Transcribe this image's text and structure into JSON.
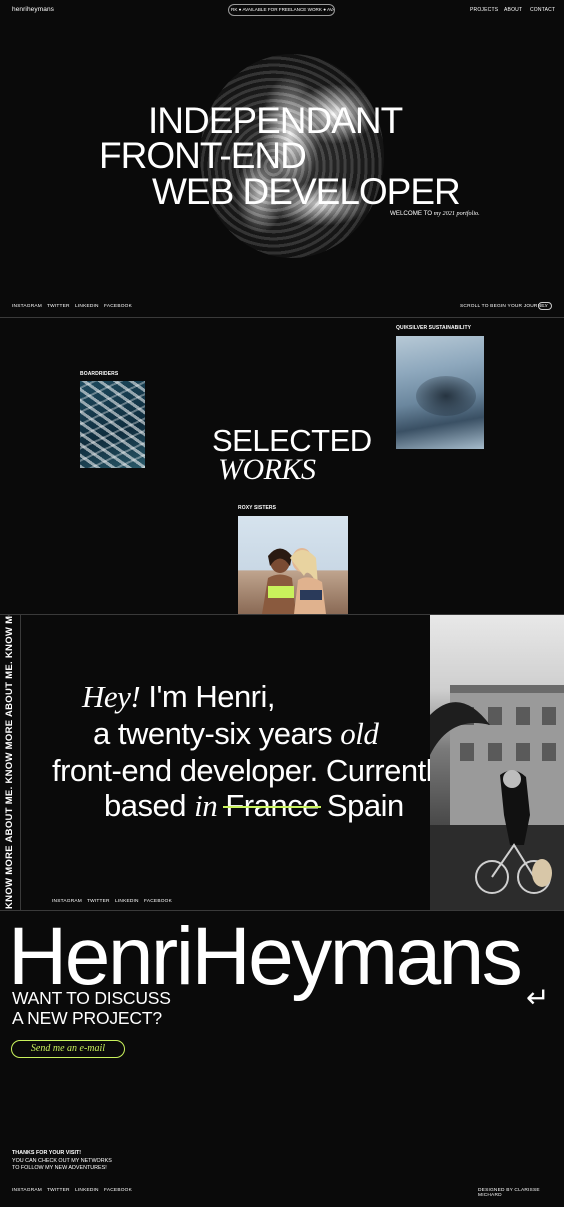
{
  "header": {
    "logo": "henriheymans",
    "availability_marquee": "RK ● AVAILABLE FOR FREELANCE WORK ● AVA",
    "nav": [
      "PROJECTS",
      "ABOUT",
      "CONTACT"
    ]
  },
  "hero": {
    "lines": [
      "INDEPENDANT",
      "FRONT-END",
      "WEB DEVELOPER"
    ],
    "welcome_prefix": "WELCOME TO",
    "welcome_italic": "my 2021 portfolio.",
    "socials": [
      "INSTAGRAM",
      "TWITTER",
      "LINKEDIN",
      "FACEBOOK"
    ],
    "scroll_text": "SCROLL TO BEGIN YOUR JOURNEY",
    "scroll_arrow": "→"
  },
  "works": {
    "title_line1": "SELECTED",
    "title_line2": "WORKS",
    "projects": [
      {
        "label": "BOARDRIDERS"
      },
      {
        "label": "QUIKSILVER SUSTAINABILITY"
      },
      {
        "label": "ROXY SISTERS"
      }
    ]
  },
  "about": {
    "side_text": "KNOW MORE ABOUT ME.   KNOW MORE ABOUT ME.   KNOW MORE ABOU",
    "line1_italic": "Hey!",
    "line1_rest": " I'm Henri,",
    "line2_pre": "a twenty-six years ",
    "line2_italic": "old",
    "line3": "front-end developer. Currently",
    "line4_pre": "based ",
    "line4_italic": "in",
    "line4_struck": "France",
    "line4_post": " Spain",
    "socials": [
      "INSTAGRAM",
      "TWITTER",
      "LINKEDIN",
      "FACEBOOK"
    ]
  },
  "contact": {
    "name": "HenriHeymans",
    "discuss_line1": "WANT TO DISCUSS",
    "discuss_line2": "A NEW PROJECT?",
    "return_arrow": "↵",
    "email_button": "Send me an e-mail",
    "thanks_line1": "THANKS FOR YOUR VISIT!",
    "thanks_line2": "YOU CAN CHECK OUT MY NETWORKS",
    "thanks_line3": "TO FOLLOW MY NEW ADVENTURES!",
    "socials": [
      "INSTAGRAM",
      "TWITTER",
      "LINKEDIN",
      "FACEBOOK"
    ],
    "credit": "DESIGNED BY CLARISSE MICHARD"
  },
  "colors": {
    "background": "#0a0a0a",
    "text": "#ffffff",
    "accent": "#c9f25c"
  }
}
